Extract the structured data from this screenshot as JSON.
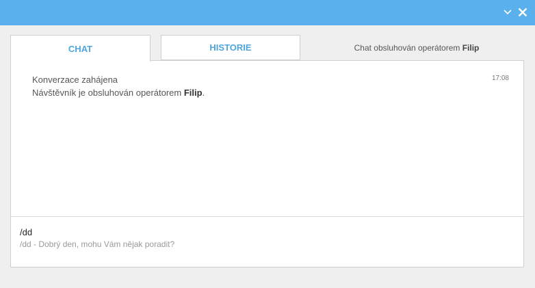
{
  "window": {
    "accent": "#5ab0ec",
    "minimize_icon": "chevron-down-icon",
    "close_icon": "close-icon"
  },
  "tabs": [
    {
      "label": "CHAT",
      "active": true
    },
    {
      "label": "HISTORIE",
      "active": false
    }
  ],
  "operator_status": {
    "prefix": "Chat obsluhován operátorem ",
    "operator": "Filip"
  },
  "messages": [
    {
      "line1": "Konverzace zahájena",
      "line2_prefix": "Návštěvník je obsluhován operátorem ",
      "line2_name": "Filip",
      "line2_suffix": ".",
      "time": "17:08"
    }
  ],
  "composer": {
    "value": "/dd",
    "suggestion": "/dd - Dobrý den, mohu Vám nějak poradit?"
  }
}
